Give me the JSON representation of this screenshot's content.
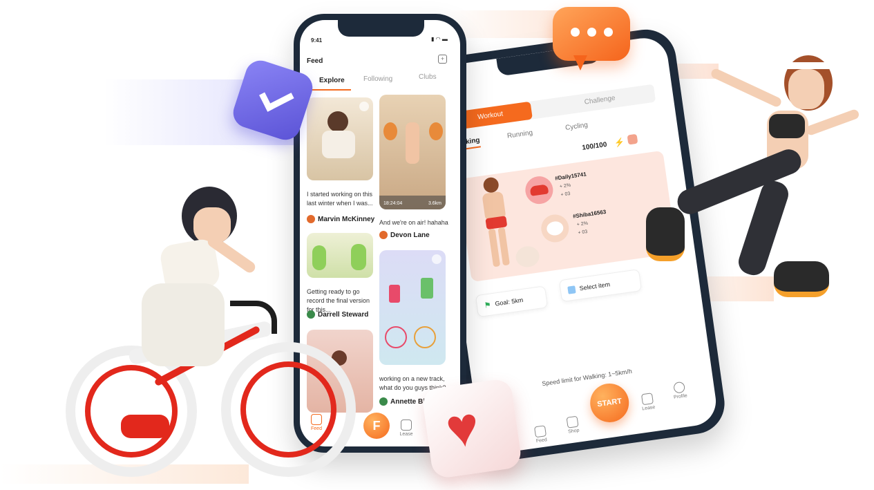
{
  "colors": {
    "accent": "#f56a1e",
    "purple": "#6b64e8",
    "red": "#e83a3a"
  },
  "feed_phone": {
    "time": "9:41",
    "title": "Feed",
    "tabs": [
      "Explore",
      "Following",
      "Clubs"
    ],
    "posts": [
      {
        "caption": "I started working on this last winter when I was...",
        "author": "Marvin McKinney"
      },
      {
        "caption": "And we're on air! hahaha",
        "author": "Devon Lane",
        "time": "18:24:04",
        "distance": "3.6km"
      },
      {
        "caption": "Getting ready to go record the final version for this...",
        "author": "Darrell Steward"
      },
      {
        "caption": "working on a new track, what do you guys think?",
        "author": "Annette Black"
      }
    ],
    "nav": {
      "feed": "Feed",
      "lease": "Lease"
    }
  },
  "workout_phone": {
    "tabs": [
      "Workout",
      "Challenge"
    ],
    "modes": [
      "Walking",
      "Running",
      "Cycling"
    ],
    "energy": "100/100",
    "shoe1": {
      "id": "#Daily15741",
      "stat1": "+ 2%",
      "stat2": "+ 03"
    },
    "shoe2": {
      "id": "#Shiba16563",
      "stat1": "+ 2%",
      "stat2": "+ 03"
    },
    "goal": "Goal: 5km",
    "select": "Select item",
    "speed_limit": "Speed limit for Walking: 1~5km/h",
    "start": "START",
    "nav": [
      "Feed",
      "Shop",
      "Lease",
      "Profile"
    ]
  },
  "icons": [
    "check-bubble-icon",
    "chat-bubble-icon",
    "heart-icon"
  ]
}
